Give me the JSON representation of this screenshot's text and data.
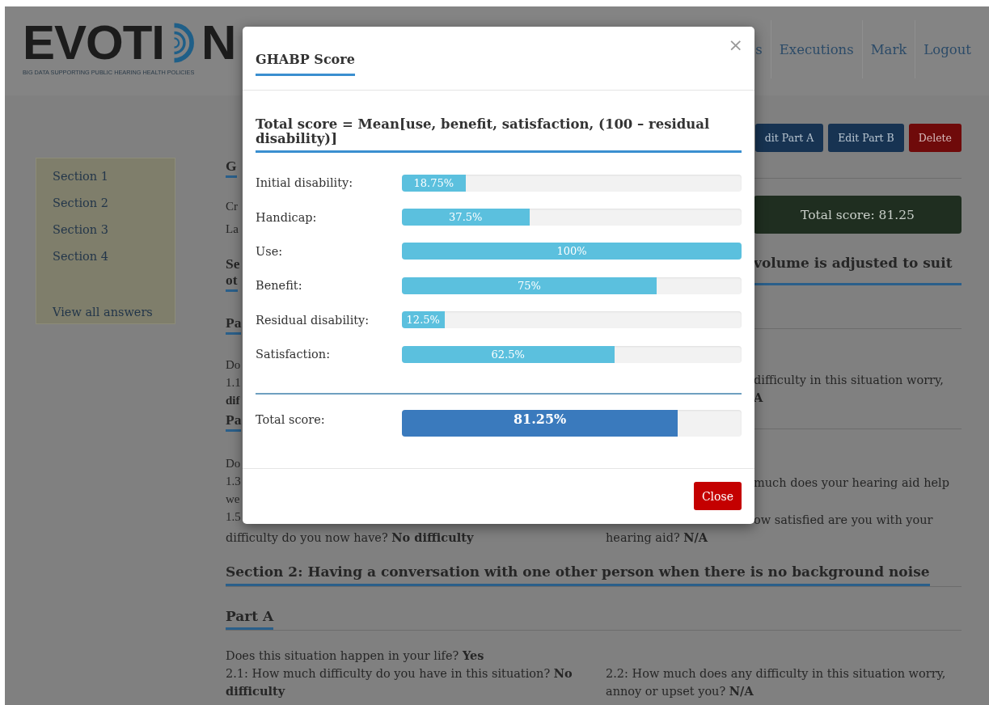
{
  "logo": {
    "text_start": "EVOTI",
    "text_end": "N",
    "tagline": "BIG DATA SUPPORTING PUBLIC HEARING HEALTH POLICIES"
  },
  "nav": [
    {
      "label": "s"
    },
    {
      "label": "Executions"
    },
    {
      "label": "Mark"
    },
    {
      "label": "Logout"
    }
  ],
  "actions": [
    {
      "label": "dit Part A",
      "kind": "edit"
    },
    {
      "label": "Edit Part B",
      "kind": "edit"
    },
    {
      "label": "Delete",
      "kind": "danger"
    }
  ],
  "sidebar": {
    "items": [
      "Section 1",
      "Section 2",
      "Section 3",
      "Section 4"
    ],
    "footer_link": "View all answers"
  },
  "left_strip": [
    "G",
    "Cr",
    "La",
    "Se",
    "ot",
    "Pa",
    "Do",
    "1.1",
    "dif",
    "Pa",
    "Do",
    "1.3",
    "we",
    "1.5"
  ],
  "right_strip": [
    "Total score: 81.25",
    "volume is adjusted to suit",
    "difficulty in this situation worry,",
    "A",
    "much does your hearing aid help",
    "ow satisfied are you with your"
  ],
  "answers_row": [
    "difficulty do you now have? **No difficulty**",
    "hearing aid? **N/A**"
  ],
  "section_heading": "Section 2: Having a conversation with one other person when there is no background noise",
  "part_heading": "Part A",
  "situation": "Does this situation happen in your life? **Yes**",
  "questions": [
    "2.1: How much difficulty do you have in this situation? **No difficulty**",
    "2.2: How much does any difficulty in this situation worry, annoy or upset you? **N/A**"
  ],
  "modal": {
    "title": "GHABP Score",
    "close_icon": "×",
    "formula": "Total score = Mean[use, benefit, satisfaction, (100 – residual disability)]",
    "scores": [
      {
        "label": "Initial disability:",
        "level": 0.1875,
        "reading": "18.75%"
      },
      {
        "label": "Handicap:",
        "level": 0.375,
        "reading": "37.5%"
      },
      {
        "label": "Use:",
        "level": 1,
        "reading": "100%"
      },
      {
        "label": "Benefit:",
        "level": 0.75,
        "reading": "75%"
      },
      {
        "label": "Residual disability:",
        "level": 0.125,
        "reading": "12.5%"
      },
      {
        "label": "Satisfaction:",
        "level": 0.625,
        "reading": "62.5%"
      }
    ],
    "total": {
      "label": "Total score:",
      "level": 0.8125,
      "reading": "81.25%"
    },
    "close_button": "Close"
  }
}
